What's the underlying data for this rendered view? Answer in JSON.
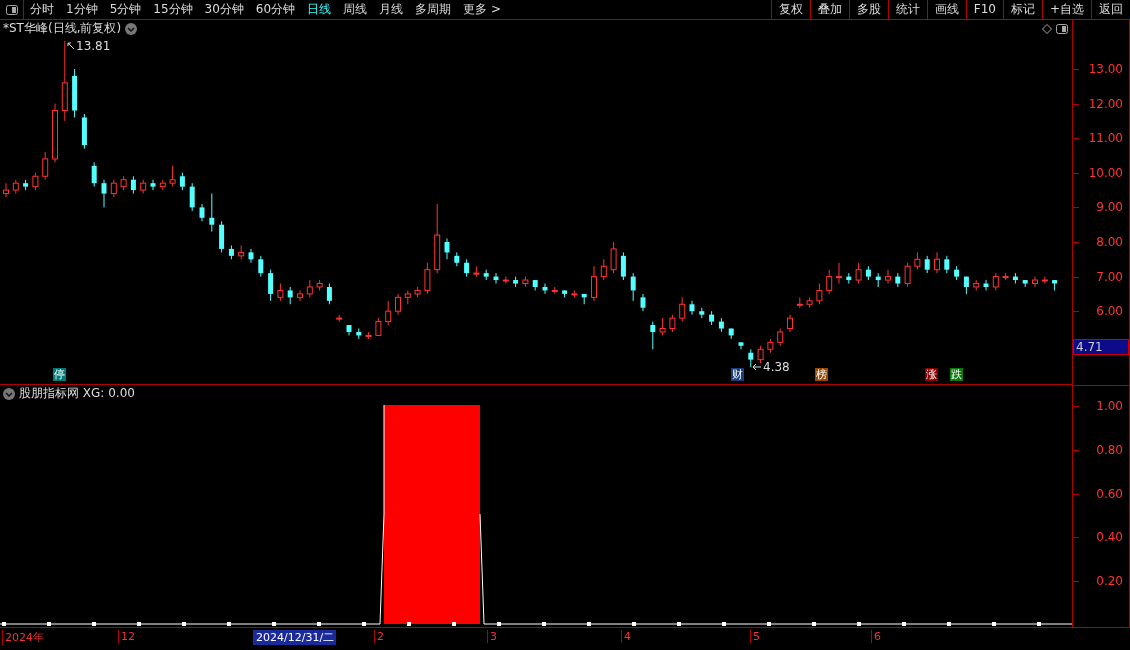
{
  "toolbar": {
    "periods": [
      {
        "label": "分时",
        "selected": false
      },
      {
        "label": "1分钟",
        "selected": false
      },
      {
        "label": "5分钟",
        "selected": false
      },
      {
        "label": "15分钟",
        "selected": false
      },
      {
        "label": "30分钟",
        "selected": false
      },
      {
        "label": "60分钟",
        "selected": false
      },
      {
        "label": "日线",
        "selected": true
      },
      {
        "label": "周线",
        "selected": false
      },
      {
        "label": "月线",
        "selected": false
      },
      {
        "label": "多周期",
        "selected": false
      },
      {
        "label": "更多 >",
        "selected": false
      }
    ],
    "actions": [
      "复权",
      "叠加",
      "多股",
      "统计",
      "画线",
      "F10",
      "标记",
      "+自选",
      "返回"
    ]
  },
  "price_chart": {
    "title": "*ST华峰(日线,前复权)",
    "high_label": "13.81",
    "low_label": "4.38",
    "axis_labels": [
      "13.00",
      "12.00",
      "11.00",
      "10.00",
      "9.00",
      "8.00",
      "7.00",
      "6.00"
    ],
    "current_price": "4.71",
    "chart_data": {
      "type": "candlestick",
      "ohlc": [
        [
          9.4,
          9.7,
          9.3,
          9.5
        ],
        [
          9.5,
          9.8,
          9.4,
          9.7
        ],
        [
          9.7,
          9.8,
          9.5,
          9.6
        ],
        [
          9.6,
          10.0,
          9.5,
          9.9
        ],
        [
          9.9,
          10.6,
          9.8,
          10.4
        ],
        [
          10.4,
          12.0,
          10.3,
          11.8
        ],
        [
          11.8,
          13.81,
          11.5,
          12.6
        ],
        [
          12.8,
          13.0,
          11.6,
          11.8
        ],
        [
          11.6,
          11.7,
          10.7,
          10.8
        ],
        [
          10.2,
          10.3,
          9.6,
          9.7
        ],
        [
          9.7,
          9.8,
          9.0,
          9.4
        ],
        [
          9.4,
          9.8,
          9.3,
          9.7
        ],
        [
          9.6,
          9.9,
          9.5,
          9.8
        ],
        [
          9.8,
          9.9,
          9.4,
          9.5
        ],
        [
          9.5,
          9.8,
          9.4,
          9.7
        ],
        [
          9.7,
          9.8,
          9.5,
          9.6
        ],
        [
          9.6,
          9.8,
          9.5,
          9.7
        ],
        [
          9.7,
          10.2,
          9.6,
          9.8
        ],
        [
          9.9,
          10.0,
          9.5,
          9.6
        ],
        [
          9.6,
          9.7,
          8.9,
          9.0
        ],
        [
          9.0,
          9.1,
          8.6,
          8.7
        ],
        [
          8.7,
          9.4,
          8.3,
          8.5
        ],
        [
          8.5,
          8.6,
          7.7,
          7.8
        ],
        [
          7.8,
          7.9,
          7.5,
          7.6
        ],
        [
          7.6,
          7.9,
          7.5,
          7.7
        ],
        [
          7.7,
          7.8,
          7.4,
          7.5
        ],
        [
          7.5,
          7.6,
          7.0,
          7.1
        ],
        [
          7.1,
          7.2,
          6.3,
          6.5
        ],
        [
          6.4,
          6.8,
          6.3,
          6.6
        ],
        [
          6.6,
          6.7,
          6.2,
          6.4
        ],
        [
          6.4,
          6.6,
          6.3,
          6.5
        ],
        [
          6.5,
          6.9,
          6.4,
          6.7
        ],
        [
          6.7,
          6.9,
          6.6,
          6.8
        ],
        [
          6.7,
          6.8,
          6.2,
          6.3
        ],
        [
          5.8,
          5.9,
          5.7,
          5.8
        ],
        [
          5.6,
          5.6,
          5.3,
          5.4
        ],
        [
          5.4,
          5.5,
          5.2,
          5.3
        ],
        [
          5.3,
          5.4,
          5.2,
          5.3
        ],
        [
          5.3,
          5.8,
          5.3,
          5.7
        ],
        [
          5.7,
          6.3,
          5.6,
          6.0
        ],
        [
          6.0,
          6.5,
          5.9,
          6.4
        ],
        [
          6.4,
          6.6,
          6.2,
          6.5
        ],
        [
          6.5,
          6.7,
          6.4,
          6.6
        ],
        [
          6.6,
          7.4,
          6.5,
          7.2
        ],
        [
          7.2,
          9.1,
          7.1,
          8.2
        ],
        [
          8.0,
          8.1,
          7.5,
          7.7
        ],
        [
          7.6,
          7.7,
          7.3,
          7.4
        ],
        [
          7.4,
          7.5,
          7.0,
          7.1
        ],
        [
          7.1,
          7.3,
          7.0,
          7.1
        ],
        [
          7.1,
          7.2,
          6.9,
          7.0
        ],
        [
          7.0,
          7.1,
          6.8,
          6.9
        ],
        [
          6.9,
          7.0,
          6.8,
          6.9
        ],
        [
          6.9,
          7.0,
          6.7,
          6.8
        ],
        [
          6.8,
          7.0,
          6.7,
          6.9
        ],
        [
          6.9,
          6.9,
          6.6,
          6.7
        ],
        [
          6.7,
          6.8,
          6.5,
          6.6
        ],
        [
          6.6,
          6.7,
          6.5,
          6.6
        ],
        [
          6.6,
          6.6,
          6.4,
          6.5
        ],
        [
          6.5,
          6.6,
          6.4,
          6.5
        ],
        [
          6.5,
          6.5,
          6.2,
          6.4
        ],
        [
          6.4,
          7.3,
          6.3,
          7.0
        ],
        [
          7.0,
          7.5,
          6.9,
          7.3
        ],
        [
          7.2,
          8.0,
          7.1,
          7.8
        ],
        [
          7.6,
          7.7,
          6.9,
          7.0
        ],
        [
          7.0,
          7.1,
          6.3,
          6.6
        ],
        [
          6.4,
          6.5,
          6.0,
          6.1
        ],
        [
          5.6,
          5.7,
          4.9,
          5.4
        ],
        [
          5.4,
          5.8,
          5.3,
          5.5
        ],
        [
          5.5,
          5.9,
          5.4,
          5.8
        ],
        [
          5.8,
          6.4,
          5.7,
          6.2
        ],
        [
          6.2,
          6.3,
          5.9,
          6.0
        ],
        [
          6.0,
          6.1,
          5.8,
          5.9
        ],
        [
          5.9,
          6.0,
          5.6,
          5.7
        ],
        [
          5.7,
          5.8,
          5.4,
          5.5
        ],
        [
          5.5,
          5.5,
          5.2,
          5.3
        ],
        [
          5.1,
          5.1,
          4.9,
          5.0
        ],
        [
          4.8,
          4.9,
          4.38,
          4.6
        ],
        [
          4.6,
          5.0,
          4.5,
          4.9
        ],
        [
          4.9,
          5.2,
          4.8,
          5.1
        ],
        [
          5.1,
          5.5,
          5.0,
          5.4
        ],
        [
          5.5,
          5.9,
          5.4,
          5.8
        ],
        [
          6.2,
          6.4,
          6.1,
          6.2
        ],
        [
          6.2,
          6.4,
          6.1,
          6.3
        ],
        [
          6.3,
          6.8,
          6.2,
          6.6
        ],
        [
          6.6,
          7.2,
          6.5,
          7.0
        ],
        [
          7.0,
          7.4,
          6.8,
          7.0
        ],
        [
          7.0,
          7.1,
          6.8,
          6.9
        ],
        [
          6.9,
          7.4,
          6.8,
          7.2
        ],
        [
          7.2,
          7.3,
          6.9,
          7.0
        ],
        [
          7.0,
          7.1,
          6.7,
          6.9
        ],
        [
          6.9,
          7.2,
          6.8,
          7.0
        ],
        [
          7.0,
          7.1,
          6.7,
          6.8
        ],
        [
          6.8,
          7.4,
          6.7,
          7.3
        ],
        [
          7.3,
          7.7,
          7.2,
          7.5
        ],
        [
          7.5,
          7.6,
          7.1,
          7.2
        ],
        [
          7.2,
          7.7,
          7.1,
          7.5
        ],
        [
          7.5,
          7.6,
          7.1,
          7.2
        ],
        [
          7.2,
          7.3,
          6.9,
          7.0
        ],
        [
          7.0,
          7.0,
          6.5,
          6.7
        ],
        [
          6.7,
          6.9,
          6.6,
          6.8
        ],
        [
          6.8,
          6.9,
          6.6,
          6.7
        ],
        [
          6.7,
          7.1,
          6.6,
          7.0
        ],
        [
          7.0,
          7.1,
          6.9,
          7.0
        ],
        [
          7.0,
          7.1,
          6.8,
          6.9
        ],
        [
          6.9,
          6.9,
          6.7,
          6.8
        ],
        [
          6.8,
          7.0,
          6.7,
          6.9
        ],
        [
          6.9,
          7.0,
          6.8,
          6.9
        ],
        [
          6.9,
          6.9,
          6.6,
          6.8
        ]
      ]
    },
    "markers": [
      {
        "label": "停",
        "color": "#007b7b"
      },
      {
        "label": "财",
        "color": "#1c3f7a"
      },
      {
        "label": "榜",
        "color": "#9a4a00"
      },
      {
        "label": "涨",
        "color": "#8a0000"
      },
      {
        "label": "跌",
        "color": "#0a7a0a"
      }
    ]
  },
  "indicator": {
    "title": "股朋指标网 XG: 0.00",
    "axis_labels": [
      "1.00",
      "0.80",
      "0.60",
      "0.40",
      "0.20"
    ]
  },
  "date_axis": [
    {
      "label": "2024年",
      "selected": false
    },
    {
      "label": "12",
      "selected": false
    },
    {
      "label": "2024/12/31/二",
      "selected": true
    },
    {
      "label": "2",
      "selected": false
    },
    {
      "label": "3",
      "selected": false
    },
    {
      "label": "4",
      "selected": false
    },
    {
      "label": "5",
      "selected": false
    },
    {
      "label": "6",
      "selected": false
    }
  ]
}
